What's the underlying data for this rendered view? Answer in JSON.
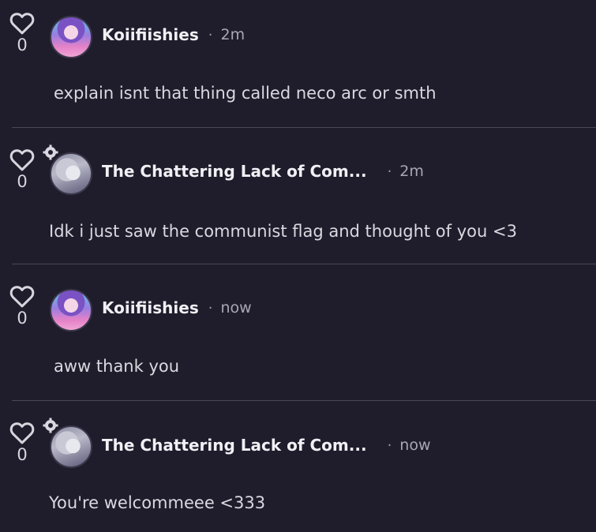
{
  "comments": [
    {
      "username": "Koiifiishies",
      "time": "2m",
      "text": "explain isnt that thing called neco arc or smth",
      "likes": "0",
      "avatar": "anime-girl-purple-hair"
    },
    {
      "username": "The Chattering Lack of Com...",
      "time": "2m",
      "text": "Idk i just saw the communist flag and thought of you <3",
      "likes": "0",
      "avatar": "anime-character-white-hair"
    },
    {
      "username": "Koiifiishies",
      "time": "now",
      "text": "aww thank you",
      "likes": "0",
      "avatar": "anime-girl-purple-hair"
    },
    {
      "username": "The Chattering Lack of Com...",
      "time": "now",
      "text": "You're welcommeee <333",
      "likes": "0",
      "avatar": "anime-character-white-hair"
    }
  ],
  "separator": "·",
  "icons": {
    "like": "heart-outline-icon",
    "badge": "gear-badge-icon"
  },
  "colors": {
    "background": "#1f1d2b",
    "divider": "#4a4858",
    "text": "#dad9e1"
  }
}
